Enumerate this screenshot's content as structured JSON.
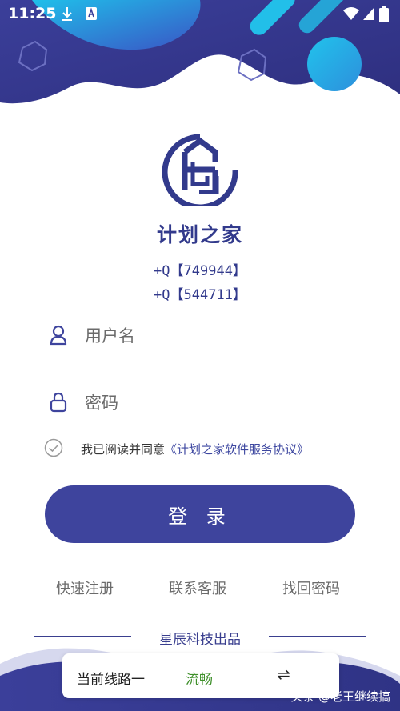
{
  "status_bar": {
    "time": "11:25"
  },
  "app": {
    "name": "计划之家",
    "qq_lines": [
      "+Q【749944】",
      "+Q【544711】"
    ]
  },
  "login_form": {
    "username_placeholder": "用户名",
    "password_placeholder": "密码",
    "agreement_prefix": "我已阅读并同意",
    "agreement_link": "《计划之家软件服务协议》",
    "agreement_checked": false,
    "login_button": "登 录"
  },
  "links": {
    "register": "快速注册",
    "support": "联系客服",
    "recover": "找回密码"
  },
  "footer": {
    "brand": "星辰科技出品",
    "route_label": "当前线路一",
    "route_status": "流畅",
    "switch_icon": "⇌"
  },
  "watermark": "头条 @老王继续搞",
  "colors": {
    "primary": "#3e449d",
    "route_status": "#3e8f2a",
    "accent_cyan": "#1ab7e6"
  }
}
